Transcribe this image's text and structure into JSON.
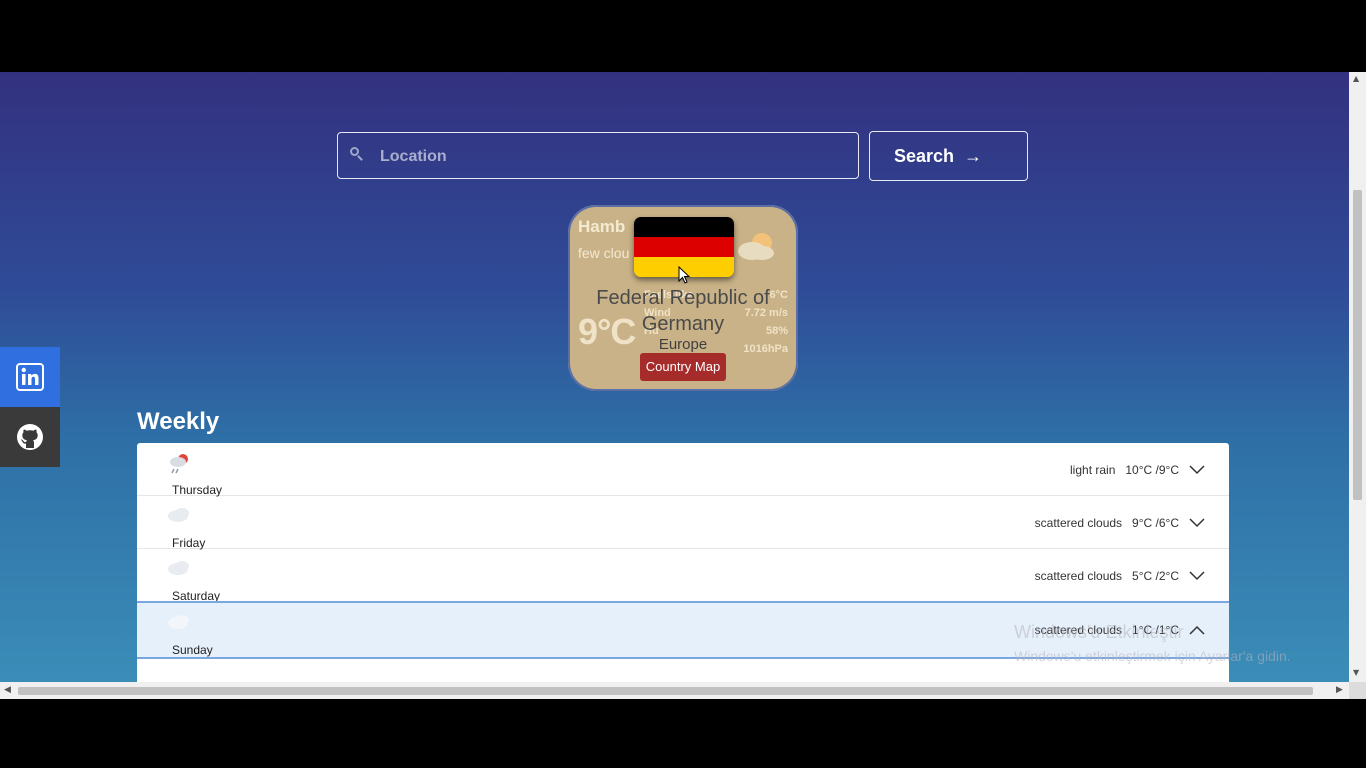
{
  "search": {
    "placeholder": "Location",
    "button_label": "Search",
    "button_arrow": "→"
  },
  "weather_card": {
    "city": "Hamb",
    "description": "few clou",
    "temperature": "9°C",
    "details": [
      {
        "label": "Feels like",
        "value": "6°C"
      },
      {
        "label": "Wind",
        "value": "7.72 m/s"
      },
      {
        "label": "Hu",
        "value": "58%"
      },
      {
        "label": "",
        "value": "1016hPa"
      }
    ]
  },
  "country_popup": {
    "name": "Federal Republic of Germany",
    "region": "Europe",
    "map_button": "Country Map",
    "flag_colors": [
      "#000000",
      "#dd0000",
      "#ffce00"
    ]
  },
  "weekly": {
    "title": "Weekly",
    "days": [
      {
        "name": "Thursday",
        "description": "light rain",
        "temps": "10°C /9°C",
        "icon": "rain-cloud-icon",
        "expanded": false
      },
      {
        "name": "Friday",
        "description": "scattered clouds",
        "temps": "9°C /6°C",
        "icon": "cloud-icon",
        "expanded": false
      },
      {
        "name": "Saturday",
        "description": "scattered clouds",
        "temps": "5°C /2°C",
        "icon": "cloud-icon",
        "expanded": false
      },
      {
        "name": "Sunday",
        "description": "scattered clouds",
        "temps": "1°C /1°C",
        "icon": "cloud-icon",
        "expanded": true
      }
    ]
  },
  "social": [
    {
      "name": "linkedin",
      "icon": "linkedin-icon",
      "color": "#2f6fe0"
    },
    {
      "name": "github",
      "icon": "github-icon",
      "color": "#3a3a3a"
    }
  ],
  "watermark": {
    "title": "Windows'u Etkinleştir",
    "subtitle": "Windows'u etkinleştirmek için Ayarlar'a gidin."
  }
}
